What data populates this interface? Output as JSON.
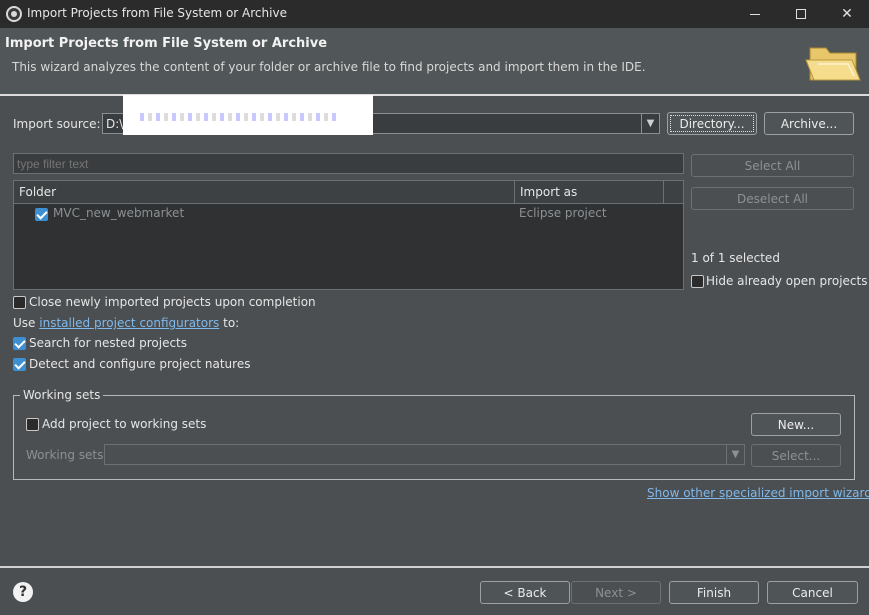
{
  "window": {
    "title": "Import Projects from File System or Archive",
    "controls": {
      "minimize_icon": "minimize-icon",
      "maximize_icon": "maximize-icon",
      "close_icon": "close-icon",
      "close_glyph": "✕"
    }
  },
  "header": {
    "title": "Import Projects from File System or Archive",
    "description": "This wizard analyzes the content of your folder or archive file to find projects and import them in the IDE."
  },
  "import_source": {
    "label": "Import source:",
    "value": "D:\\",
    "directory_button": "Directory...",
    "archive_button": "Archive..."
  },
  "filter": {
    "placeholder": "type filter text"
  },
  "table": {
    "columns": [
      "Folder",
      "Import as"
    ],
    "rows": [
      {
        "folder": "MVC_new_webmarket",
        "import_as": "Eclipse project",
        "checked": true
      }
    ]
  },
  "side_panel": {
    "select_all": "Select All",
    "deselect_all": "Deselect All",
    "selected_count": "1 of 1 selected",
    "hide_open": "Hide already open projects"
  },
  "options": {
    "close_newly": "Close newly imported projects upon completion",
    "use_prefix": "Use",
    "configurators_link": "installed project configurators",
    "use_suffix": "to:",
    "search_nested": "Search for nested projects",
    "detect_natures": "Detect and configure project natures"
  },
  "working_sets": {
    "legend": "Working sets",
    "add_label": "Add project to working sets",
    "new_button": "New...",
    "sets_label": "Working sets:",
    "select_button": "Select..."
  },
  "link_other": "Show other specialized import wizards",
  "footer": {
    "help": "?",
    "back": "< Back",
    "next": "Next >",
    "finish": "Finish",
    "cancel": "Cancel"
  }
}
